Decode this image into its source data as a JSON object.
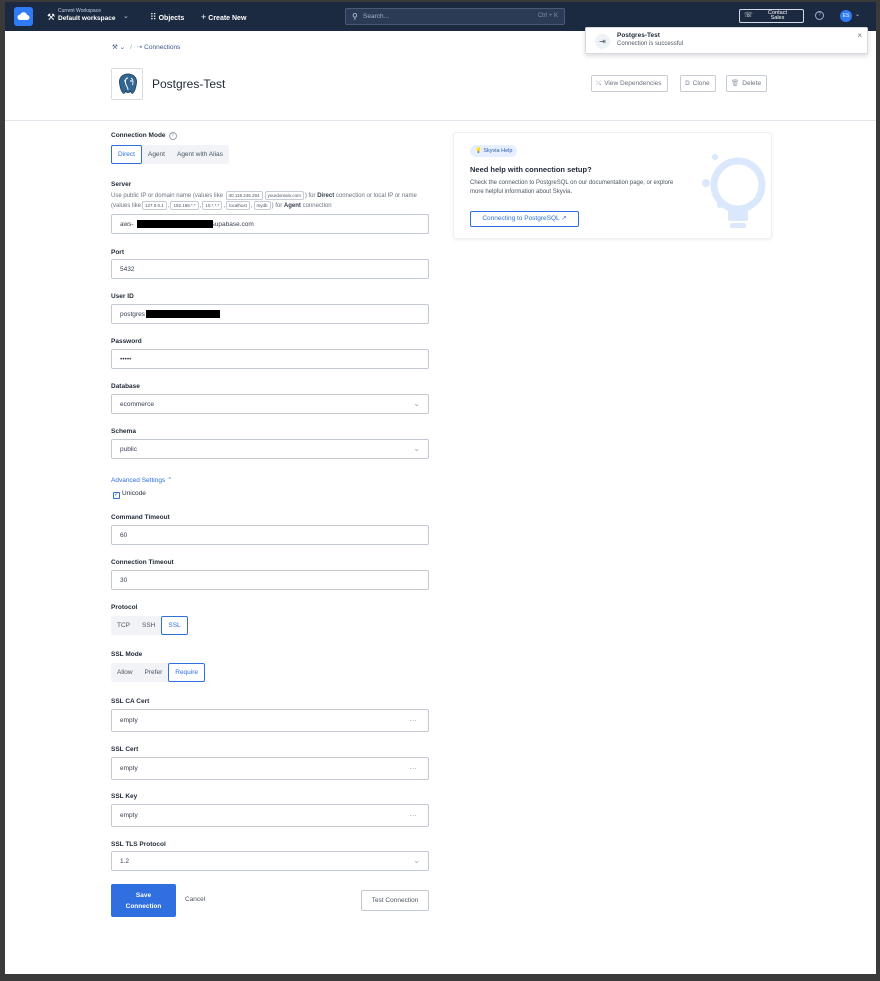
{
  "topbar": {
    "workspace_caption": "Current Workspace",
    "workspace_name": "Default workspace",
    "objects": "Objects",
    "create_new": "Create New",
    "search_placeholder": "Search...",
    "search_shortcut": "Ctrl + K",
    "contact_sales_1": "Contact",
    "contact_sales_2": "Sales",
    "avatar_initials": "ES"
  },
  "toast": {
    "title": "Postgres-Test",
    "message": "Connection is successful"
  },
  "breadcrumb": {
    "current": "Connections"
  },
  "header": {
    "title": "Postgres-Test",
    "view_dependencies": "View Dependencies",
    "clone": "Clone",
    "delete": "Delete"
  },
  "form": {
    "connection_mode_label": "Connection Mode",
    "modes": [
      "Direct",
      "Agent",
      "Agent with Alias"
    ],
    "server_label": "Server",
    "server_hint": {
      "p1": "Use public IP or domain name (values like",
      "tag1": "40.118.246.204",
      "tag2": "yourdomain.com",
      "p2": ") for",
      "b1": "Direct",
      "p3": "connection or",
      "p4": "local IP or name (values like",
      "tag3": "127.0.0.1",
      "tag4": "192.168.*.*",
      "tag5": "10.*.*.*",
      "tag6": "localhost",
      "tag7": "mydb",
      "p5": ") for",
      "b2": "Agent",
      "p6": "connection"
    },
    "server_value_prefix": "aws-",
    "server_value_suffix": ".supabase.com",
    "port_label": "Port",
    "port_value": "5432",
    "user_label": "User ID",
    "user_value_prefix": "postgres",
    "password_label": "Password",
    "password_value": "•••••",
    "database_label": "Database",
    "database_value": "ecommerce",
    "schema_label": "Schema",
    "schema_value": "public",
    "advanced_label": "Advanced Settings",
    "unicode_label": "Unicode",
    "command_timeout_label": "Command Timeout",
    "command_timeout_value": "60",
    "connection_timeout_label": "Connection Timeout",
    "connection_timeout_value": "30",
    "protocol_label": "Protocol",
    "protocols": [
      "TCP",
      "SSH",
      "SSL"
    ],
    "ssl_mode_label": "SSL Mode",
    "ssl_modes": [
      "Allow",
      "Prefer",
      "Require"
    ],
    "ssl_ca_label": "SSL CA Cert",
    "ssl_ca_value": "empty",
    "ssl_cert_label": "SSL Cert",
    "ssl_cert_value": "empty",
    "ssl_key_label": "SSL Key",
    "ssl_key_value": "empty",
    "ssl_tls_label": "SSL TLS Protocol",
    "ssl_tls_value": "1.2",
    "save_1": "Save",
    "save_2": "Connection",
    "cancel": "Cancel",
    "test": "Test Connection"
  },
  "help": {
    "badge": "Skyvia Help",
    "title": "Need help with connection setup?",
    "text": "Check the connection to PostgreSQL on our documentation page, or explore more helpful information about Skyvia.",
    "link": "Connecting to PostgreSQL"
  },
  "colors": {
    "accent": "#2f6fe0",
    "topbar": "#1b2a41"
  }
}
